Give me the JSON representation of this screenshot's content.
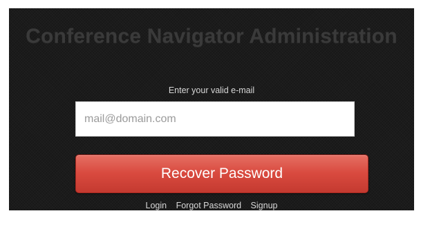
{
  "header": {
    "title": "Conference Navigator Administration"
  },
  "form": {
    "prompt": "Enter your valid e-mail",
    "email_placeholder": "mail@domain.com",
    "email_value": "",
    "submit_label": "Recover Password"
  },
  "footer_links": {
    "login": "Login",
    "forgot_password": "Forgot Password",
    "signup": "Signup"
  },
  "colors": {
    "panel_background": "#1b1b1b",
    "title_text": "#3a3a3a",
    "button_red": "#d94a3f",
    "link_text": "#d8d8d8"
  }
}
